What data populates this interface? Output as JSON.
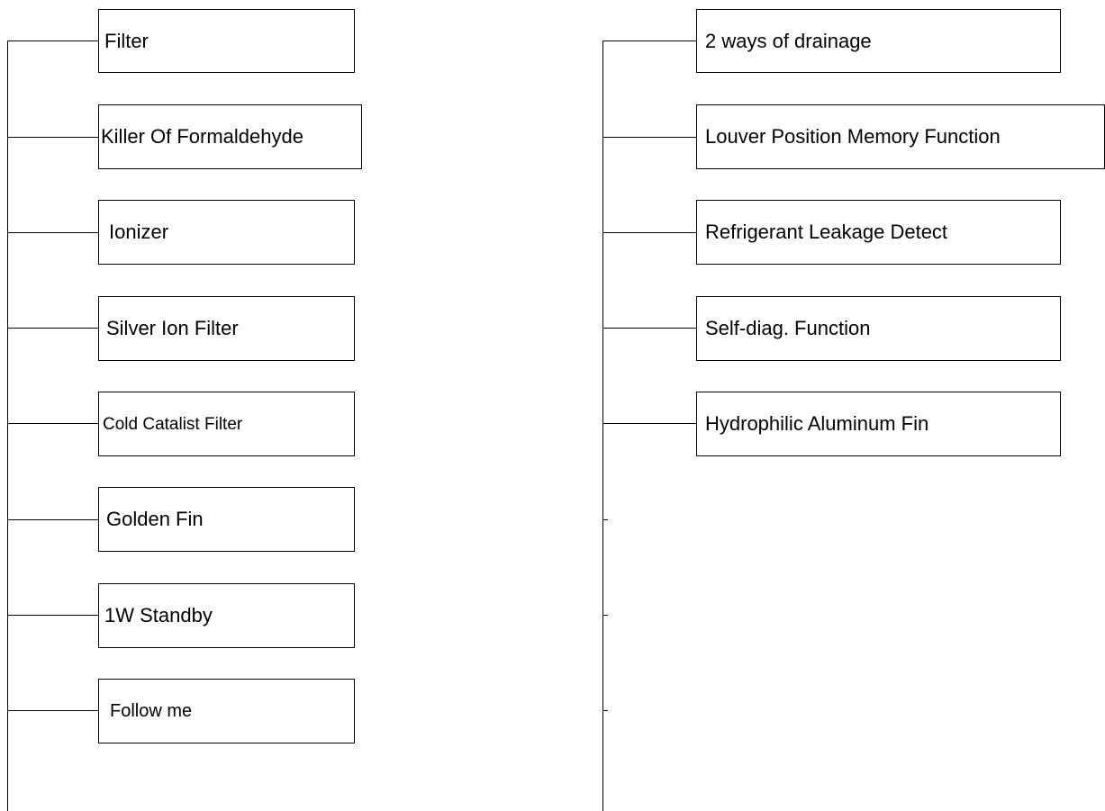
{
  "left_column": {
    "items": [
      {
        "label": "Filter"
      },
      {
        "label": "Killer Of Formaldehyde"
      },
      {
        "label": "Ionizer"
      },
      {
        "label": "Silver Ion Filter"
      },
      {
        "label": "Cold Catalist Filter"
      },
      {
        "label": "Golden Fin"
      },
      {
        "label": "1W Standby"
      },
      {
        "label": "Follow me"
      }
    ]
  },
  "right_column": {
    "items": [
      {
        "label": "2 ways of drainage"
      },
      {
        "label": "Louver Position Memory Function"
      },
      {
        "label": "Refrigerant Leakage Detect"
      },
      {
        "label": "Self-diag. Function"
      },
      {
        "label": "Hydrophilic Aluminum Fin"
      }
    ]
  },
  "colors": {
    "line": "#000000",
    "box_border": "#000000",
    "background": "#ffffff"
  }
}
